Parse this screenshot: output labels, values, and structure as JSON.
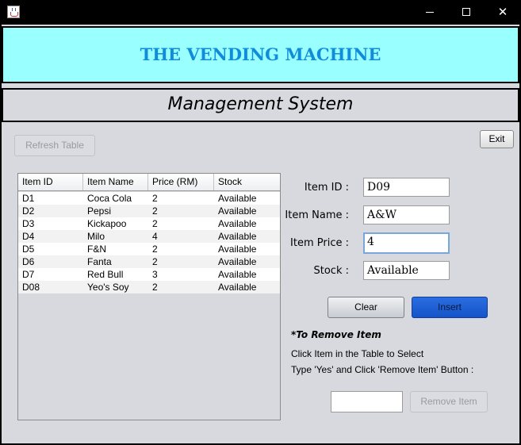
{
  "window": {
    "title": "",
    "icon": "java-cup-icon",
    "controls": {
      "minimize": "minimize-icon",
      "maximize": "maximize-icon",
      "close": "close-icon"
    },
    "close_glyph": "✕"
  },
  "header": {
    "title": "THE VENDING MACHINE",
    "subtitle": "Management System"
  },
  "toolbar": {
    "refresh_label": "Refresh Table",
    "exit_label": "Exit"
  },
  "table": {
    "columns": [
      "Item ID",
      "Item Name",
      "Price (RM)",
      "Stock"
    ],
    "rows": [
      [
        "D1",
        "Coca Cola",
        "2",
        "Available"
      ],
      [
        "D2",
        "Pepsi",
        "2",
        "Available"
      ],
      [
        "D3",
        "Kickapoo",
        "2",
        "Available"
      ],
      [
        "D4",
        "Milo",
        "4",
        "Available"
      ],
      [
        "D5",
        "F&N",
        "2",
        "Available"
      ],
      [
        "D6",
        "Fanta",
        "2",
        "Available"
      ],
      [
        "D7",
        "Red Bull",
        "3",
        "Available"
      ],
      [
        "D08",
        "Yeo's Soy",
        "2",
        "Available"
      ]
    ]
  },
  "form": {
    "item_id_label": "Item ID :",
    "item_id_value": "D09",
    "item_name_label": "Item Name :",
    "item_name_value": "A&W",
    "item_price_label": "Item Price :",
    "item_price_value": "4",
    "stock_label": "Stock :",
    "stock_value": "Available",
    "clear_label": "Clear",
    "insert_label": "Insert"
  },
  "remove": {
    "heading": "*To Remove Item",
    "line1": "Click Item in the Table to Select",
    "line2": "Type 'Yes' and Click 'Remove Item' Button :",
    "input_value": "",
    "button_label": "Remove Item"
  },
  "colors": {
    "banner_bg": "#99ffff",
    "banner_text": "#118cd8",
    "insert_button": "#1553c9",
    "panel_bg": "#d7d9df"
  }
}
